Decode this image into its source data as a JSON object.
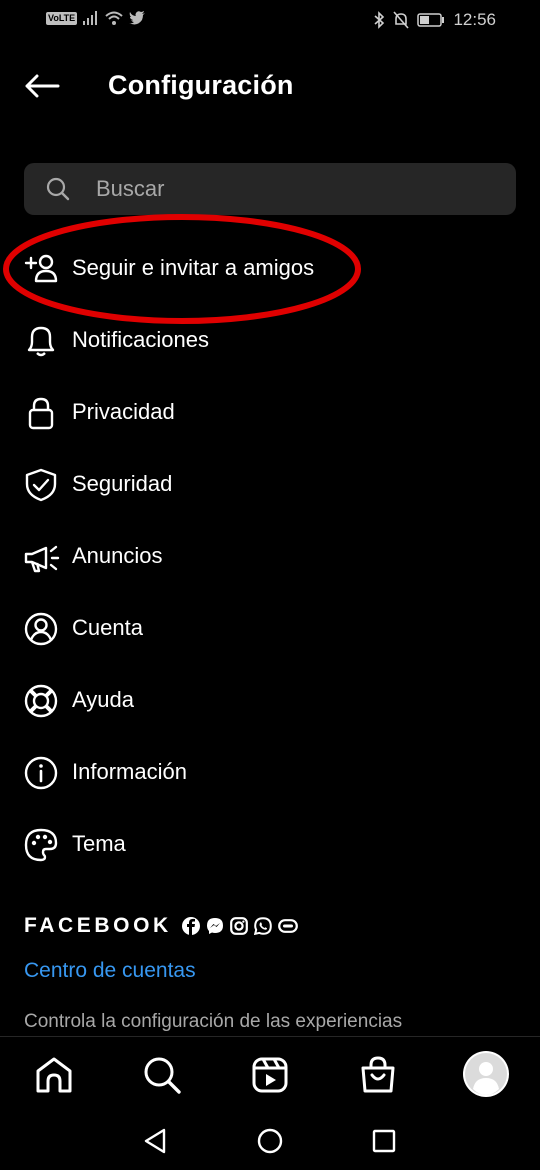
{
  "status_bar": {
    "volte": "VoLTE",
    "time": "12:56"
  },
  "header": {
    "title": "Configuración"
  },
  "search": {
    "placeholder": "Buscar"
  },
  "menu": [
    {
      "label": "Seguir e invitar a amigos",
      "icon": "add-person-icon"
    },
    {
      "label": "Notificaciones",
      "icon": "bell-icon"
    },
    {
      "label": "Privacidad",
      "icon": "lock-icon"
    },
    {
      "label": "Seguridad",
      "icon": "shield-icon"
    },
    {
      "label": "Anuncios",
      "icon": "megaphone-icon"
    },
    {
      "label": "Cuenta",
      "icon": "account-icon"
    },
    {
      "label": "Ayuda",
      "icon": "lifebuoy-icon"
    },
    {
      "label": "Información",
      "icon": "info-icon"
    },
    {
      "label": "Tema",
      "icon": "palette-icon"
    }
  ],
  "facebook_section": {
    "brand": "FACEBOOK",
    "link": "Centro de cuentas",
    "description": "Controla la configuración de las experiencias"
  },
  "colors": {
    "background": "#000000",
    "link": "#3797f0",
    "highlight": "#e00000",
    "search_bg": "#262626"
  }
}
